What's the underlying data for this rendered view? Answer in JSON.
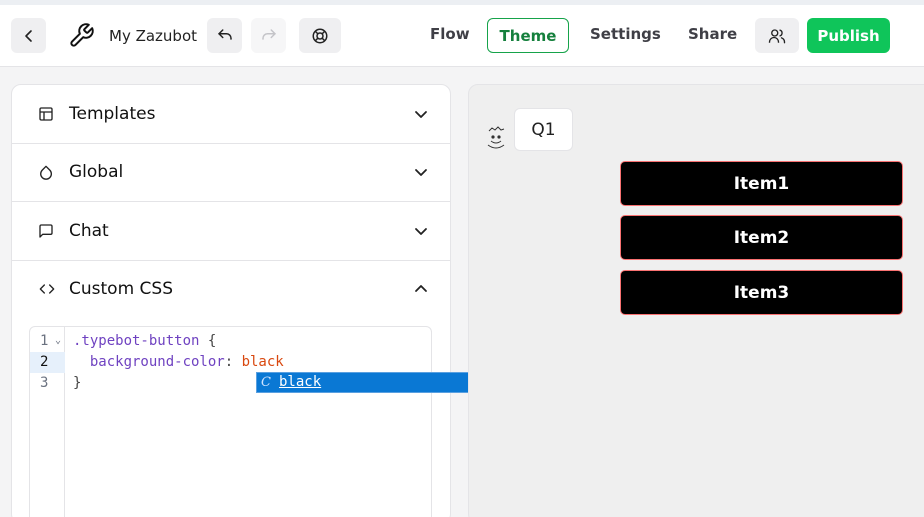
{
  "topbar": {
    "bot_name": "My Zazubot",
    "nav": {
      "flow": "Flow",
      "theme": "Theme",
      "settings": "Settings",
      "share": "Share"
    },
    "publish_label": "Publish",
    "colors": {
      "accent": "#16a34a",
      "publish_bg": "#0fc55a"
    }
  },
  "sidebar": {
    "items": [
      {
        "label": "Templates",
        "icon": "layout-icon",
        "expanded": false
      },
      {
        "label": "Global",
        "icon": "droplet-icon",
        "expanded": false
      },
      {
        "label": "Chat",
        "icon": "message-square-icon",
        "expanded": false
      },
      {
        "label": "Custom CSS",
        "icon": "code-icon",
        "expanded": true
      }
    ]
  },
  "editor": {
    "line_numbers": [
      "1",
      "2",
      "3"
    ],
    "active_line": 2,
    "lines": {
      "l1_selector": ".typebot-button",
      "l1_brace": " {",
      "l2_indent": "  ",
      "l2_prop": "background-color",
      "l2_colon": ": ",
      "l2_value": "black",
      "l3_brace": "}"
    },
    "suggestion": {
      "kind_icon": "C",
      "text": "black"
    }
  },
  "preview": {
    "bot_message": "Q1",
    "choices": [
      "Item1",
      "Item2",
      "Item3"
    ],
    "button_bg": "#000000",
    "button_border": "#f87171"
  }
}
